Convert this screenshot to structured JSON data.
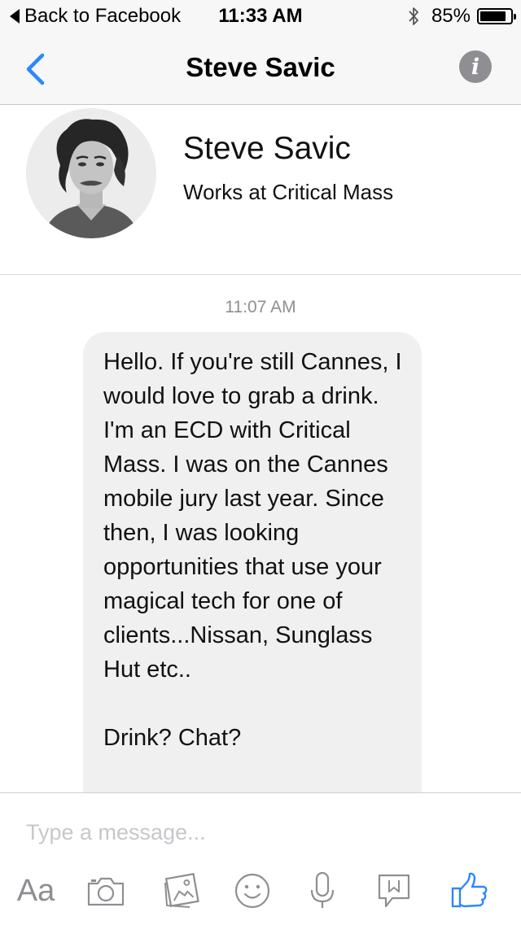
{
  "status_bar": {
    "back_label": "Back to Facebook",
    "time": "11:33 AM",
    "battery": "85%",
    "battery_level": 0.85
  },
  "nav": {
    "title": "Steve Savic",
    "info_glyph": "i"
  },
  "profile": {
    "name": "Steve Savic",
    "subtitle": "Works at Critical Mass"
  },
  "conversation": {
    "timestamp": "11:07 AM",
    "messages": [
      {
        "direction": "incoming",
        "text": "Hello. If you're still Cannes, I would love to grab a drink. I'm an ECD with Critical Mass. I was on the Cannes mobile jury last year. Since then, I was looking opportunities that use your magical tech for one of clients...Nissan, Sunglass Hut etc..\n\nDrink? Chat?"
      }
    ]
  },
  "composer": {
    "placeholder": "Type a message...",
    "value": "",
    "aa_label": "Aa",
    "tools": [
      "text-format-icon",
      "camera-icon",
      "photo-gallery-icon",
      "emoji-icon",
      "microphone-icon",
      "sticker-icon",
      "like-icon"
    ]
  },
  "colors": {
    "accent": "#2b87ff",
    "bubble": "#f1f0f0",
    "muted": "#8e8e93",
    "bar_bg": "#f7f7f7"
  }
}
